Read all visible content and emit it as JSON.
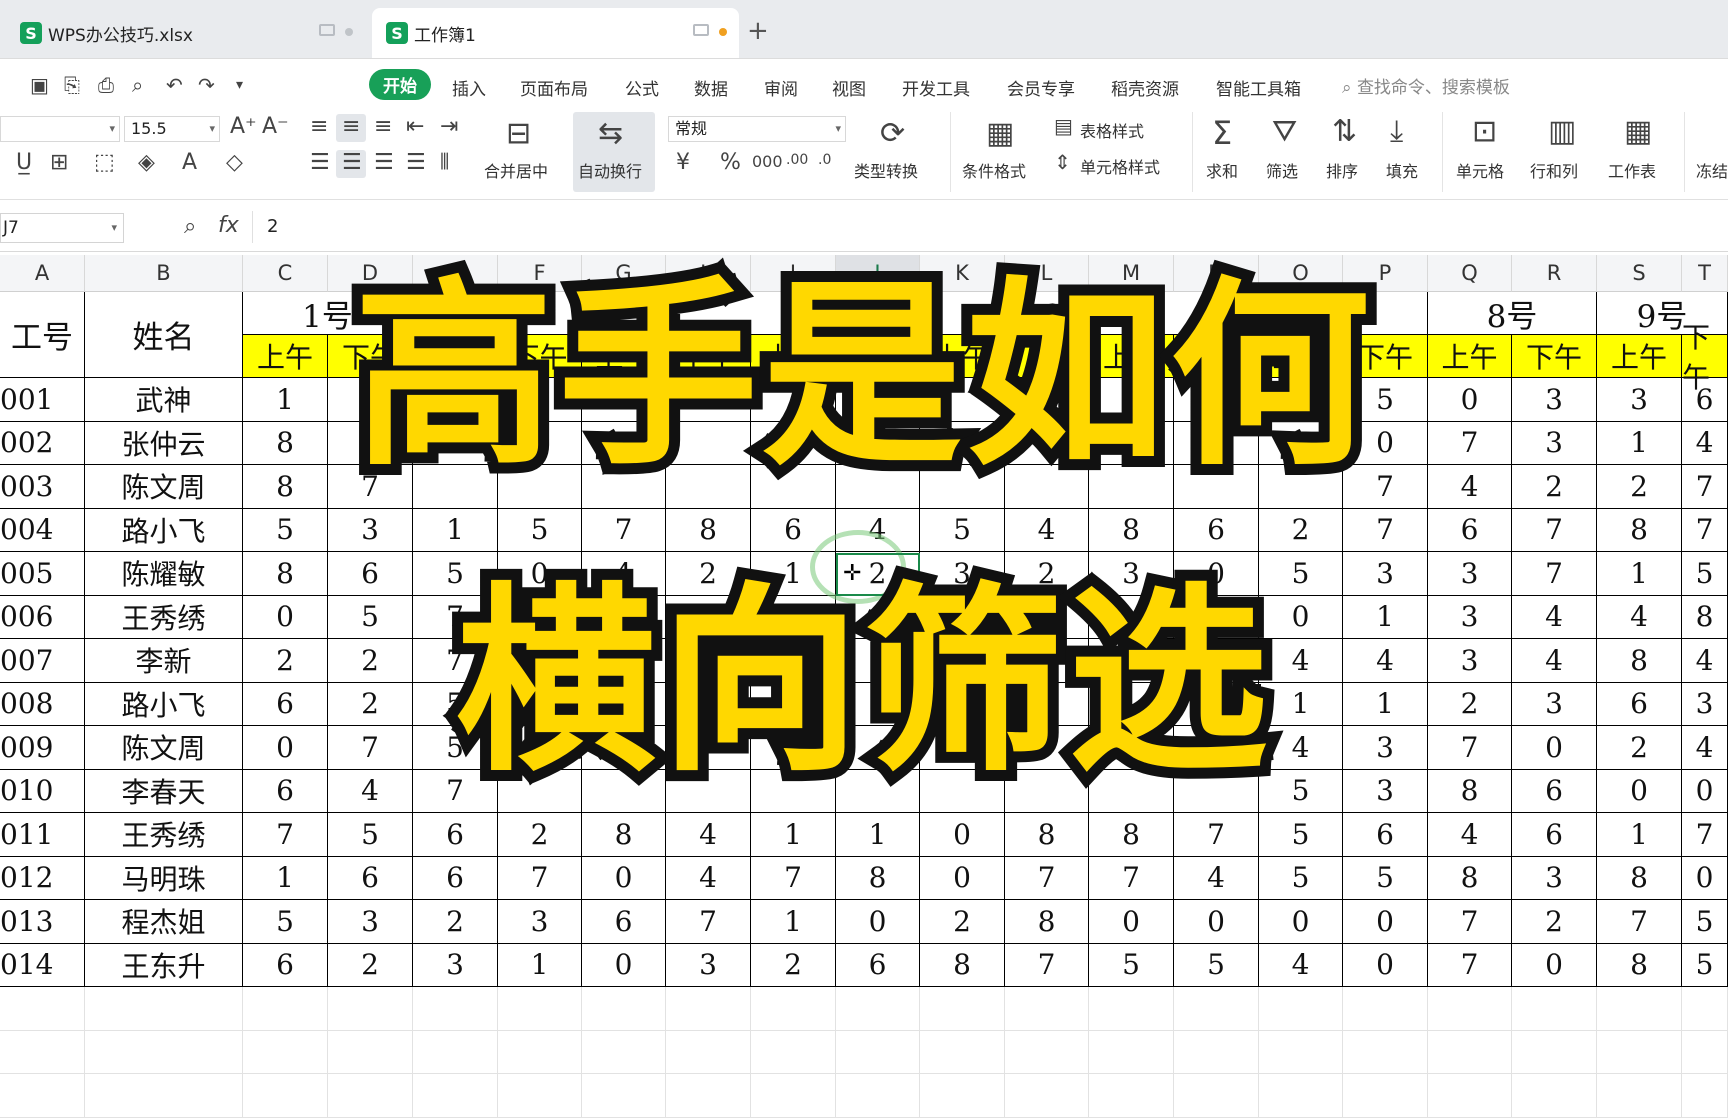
{
  "tabs": [
    {
      "icon": "S",
      "label": "WPS办公技巧.xlsx"
    },
    {
      "icon": "S",
      "label": "工作簿1"
    }
  ],
  "menu": {
    "active": "开始",
    "items": [
      "插入",
      "页面布局",
      "公式",
      "数据",
      "审阅",
      "视图",
      "开发工具",
      "会员专享",
      "稻壳资源",
      "智能工具箱"
    ],
    "search": "查找命令、搜索模板"
  },
  "ribbon": {
    "font_size": "15.5",
    "number_format": "常规",
    "merge": "合并居中",
    "wrap": "自动换行",
    "convert": "类型转换",
    "cond_format": "条件格式",
    "table_style": "表格样式",
    "cell_style": "单元格样式",
    "sum": "求和",
    "filter": "筛选",
    "sort": "排序",
    "fill": "填充",
    "cells": "单元格",
    "rowcol": "行和列",
    "sheet": "工作表",
    "freeze": "冻结"
  },
  "formula": {
    "cell_ref": "J7",
    "fx": "fx",
    "value": "2"
  },
  "columns": [
    "A",
    "B",
    "C",
    "D",
    "E",
    "F",
    "G",
    "H",
    "I",
    "J",
    "K",
    "L",
    "M",
    "N",
    "O",
    "P",
    "Q",
    "R",
    "S",
    "T"
  ],
  "sheet": {
    "hdr_id": "工号",
    "hdr_name": "姓名",
    "days": [
      "1号",
      "7号",
      "8号",
      "9号"
    ],
    "am": "上午",
    "pm": "下午",
    "rows": [
      {
        "id": "001",
        "name": "武神",
        "left": [
          "1",
          "0"
        ],
        "right": [
          "5",
          "0",
          "3",
          "3",
          "6"
        ]
      },
      {
        "id": "002",
        "name": "张仲云",
        "left": [
          "8",
          "3"
        ],
        "right": [
          "0",
          "7",
          "3",
          "1",
          "4"
        ]
      },
      {
        "id": "003",
        "name": "陈文周",
        "left": [
          "8",
          "7"
        ],
        "right": [
          "7",
          "4",
          "2",
          "2",
          "7"
        ]
      },
      {
        "id": "004",
        "name": "路小飞",
        "left": [
          "5",
          "3",
          "1",
          "5",
          "7",
          "8",
          "6",
          "4",
          "5",
          "4",
          "8",
          "6",
          "2"
        ],
        "right": [
          "7",
          "6",
          "7",
          "8",
          "7"
        ]
      },
      {
        "id": "005",
        "name": "陈耀敏",
        "left": [
          "8",
          "6",
          "5",
          "0",
          "4",
          "2",
          "1",
          "2",
          "3",
          "2",
          "3",
          "0",
          "5"
        ],
        "right": [
          "3",
          "3",
          "7",
          "1",
          "5"
        ]
      },
      {
        "id": "006",
        "name": "王秀绣",
        "left": [
          "0",
          "5",
          "7"
        ],
        "right": [
          "0",
          "1",
          "3",
          "4",
          "4",
          "8"
        ]
      },
      {
        "id": "007",
        "name": "李新",
        "left": [
          "2",
          "2",
          "7"
        ],
        "right": [
          "4",
          "4",
          "3",
          "4",
          "8",
          "4"
        ]
      },
      {
        "id": "008",
        "name": "路小飞",
        "left": [
          "6",
          "2",
          "5"
        ],
        "right": [
          "1",
          "1",
          "2",
          "3",
          "6",
          "3"
        ]
      },
      {
        "id": "009",
        "name": "陈文周",
        "left": [
          "0",
          "7",
          "5"
        ],
        "right": [
          "4",
          "3",
          "7",
          "0",
          "2",
          "4"
        ]
      },
      {
        "id": "010",
        "name": "李春天",
        "left": [
          "6",
          "4",
          "7"
        ],
        "right": [
          "5",
          "3",
          "8",
          "6",
          "0",
          "0"
        ]
      },
      {
        "id": "011",
        "name": "王秀绣",
        "left": [
          "7",
          "5",
          "6",
          "2",
          "8",
          "4",
          "1",
          "1",
          "0",
          "8",
          "8",
          "7",
          "5"
        ],
        "right": [
          "6",
          "4",
          "6",
          "1",
          "7"
        ]
      },
      {
        "id": "012",
        "name": "马明珠",
        "left": [
          "1",
          "6",
          "6",
          "7",
          "0",
          "4",
          "7",
          "8",
          "0",
          "7",
          "7",
          "4",
          "5"
        ],
        "right": [
          "5",
          "8",
          "3",
          "8",
          "0"
        ]
      },
      {
        "id": "013",
        "name": "程杰姐",
        "left": [
          "5",
          "3",
          "2",
          "3",
          "6",
          "7",
          "1",
          "0",
          "2",
          "8",
          "0",
          "0",
          "0"
        ],
        "right": [
          "0",
          "7",
          "2",
          "7",
          "5"
        ]
      },
      {
        "id": "014",
        "name": "王东升",
        "left": [
          "6",
          "2",
          "3",
          "1",
          "0",
          "3",
          "2",
          "6",
          "8",
          "7",
          "5",
          "5",
          "4"
        ],
        "right": [
          "0",
          "7",
          "0",
          "8",
          "5"
        ]
      }
    ]
  },
  "overlay": {
    "line1": "高手是如何",
    "line2": "横向筛选"
  }
}
